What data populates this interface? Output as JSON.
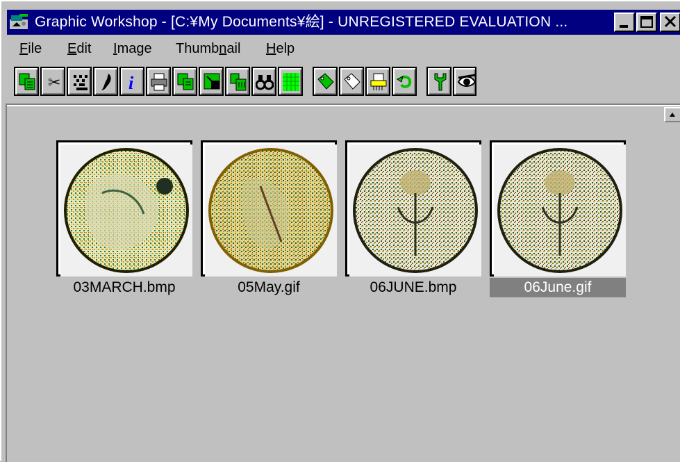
{
  "window": {
    "title": "Graphic Workshop - [C:¥My Documents¥絵] - UNREGISTERED EVALUATION ..."
  },
  "menu": {
    "items": [
      {
        "first": "F",
        "rest": "ile"
      },
      {
        "first": "E",
        "rest": "dit"
      },
      {
        "first": "I",
        "rest": "mage"
      },
      {
        "pre": "Thumb",
        "first": "n",
        "rest": "ail"
      },
      {
        "first": "H",
        "rest": "elp"
      }
    ]
  },
  "toolbar": {
    "tools": [
      "copy-icon",
      "cut-icon",
      "dither-icon",
      "brush-icon",
      "info-icon",
      "print-icon",
      "duplicate-icon",
      "convert-icon",
      "batch-icon",
      "find-icon",
      "grid-icon",
      "tag-icon",
      "untag-icon",
      "shred-icon",
      "undo-icon",
      "tools-icon",
      "view-icon"
    ]
  },
  "thumbnails": [
    {
      "label": "03MARCH.bmp",
      "selected": false
    },
    {
      "label": "05May.gif",
      "selected": false
    },
    {
      "label": "06JUNE.bmp",
      "selected": false
    },
    {
      "label": "06June.gif",
      "selected": true
    }
  ],
  "colors": {
    "titlebar": "#000080",
    "face": "#c0c0c0",
    "selection": "#808080",
    "icon_green": "#00c000",
    "icon_yellow": "#ffff00"
  }
}
